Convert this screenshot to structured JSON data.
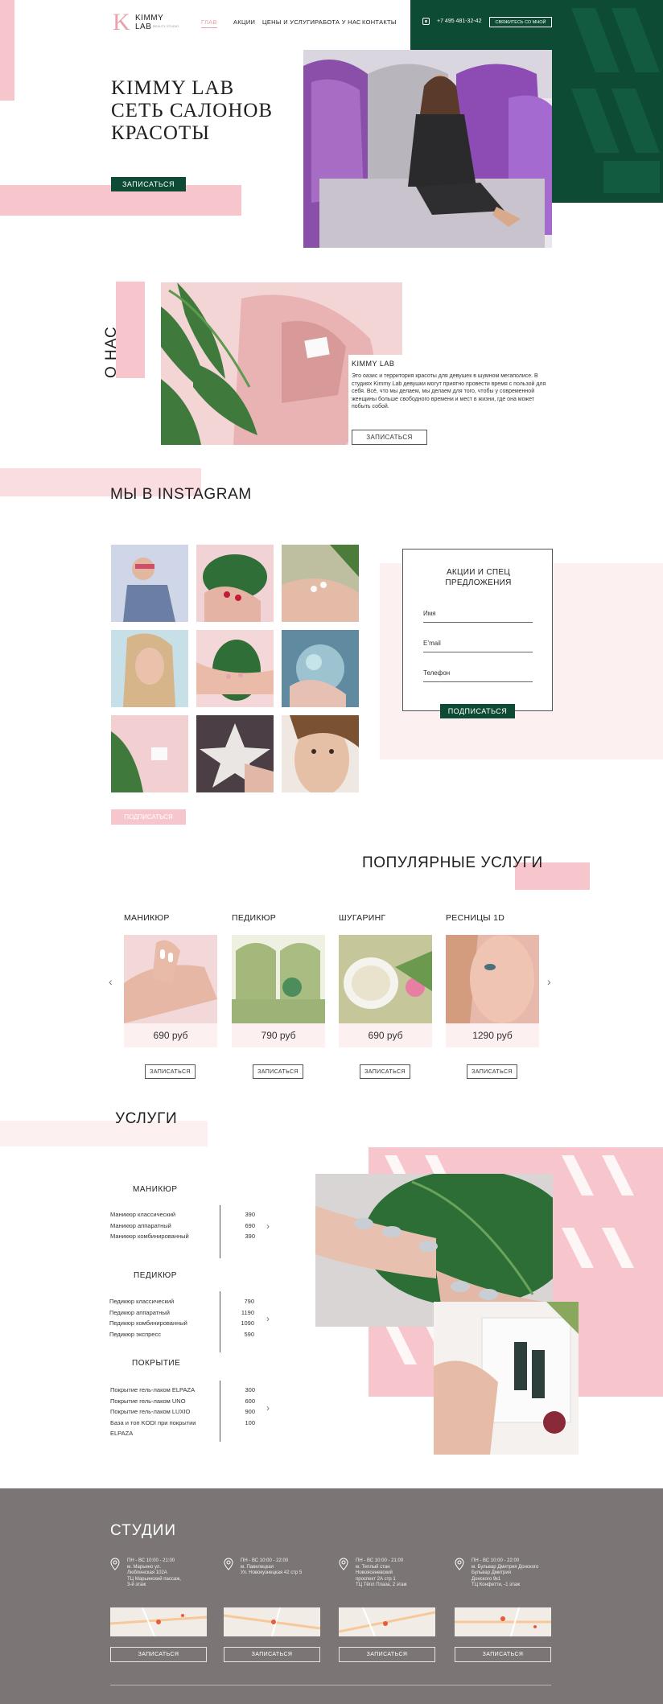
{
  "header": {
    "logo_letter": "K",
    "logo_name": "KIMMY LAB",
    "logo_sub": "BEAUTY STUDIO",
    "nav": [
      "ГЛАВ",
      "АКЦИИ",
      "ЦЕНЫ И УСЛУГИ",
      "РАБОТА У НАС",
      "КОНТАКТЫ"
    ],
    "phone": "+7 495 481-32-42",
    "contact_button": "СВЯЖИТЕСЬ СО МНОЙ"
  },
  "hero": {
    "title_lines": [
      "KIMMY LAB",
      "СЕТЬ САЛОНОВ",
      "КРАСОТЫ"
    ],
    "button": "ЗАПИСАТЬСЯ"
  },
  "about": {
    "vertical_title": "О НАС",
    "card_title": "KIMMY LAB",
    "text": "Это оазис и территория красоты для девушек в шумном мегаполисе. В студиях Kimmy Lab девушки могут приятно провести время с пользой для себя. Всё, что мы делаем, мы делаем для того, чтобы у современной женщины больше свободного времени и мест в жизни, где она может побыть собой.",
    "button": "ЗАПИСАТЬСЯ"
  },
  "instagram": {
    "title": "МЫ В INSTAGRAM",
    "subscribe_button": "ПОДПИСАТЬСЯ"
  },
  "promo_form": {
    "title": "АКЦИИ И СПЕЦ ПРЕДЛОЖЕНИЯ",
    "fields": [
      "Имя",
      "E’mail",
      "Телефон"
    ],
    "button": "ПОДПИСАТЬСЯ"
  },
  "popular": {
    "title": "ПОПУЛЯРНЫЕ УСЛУГИ",
    "cards": [
      {
        "name": "МАНИКЮР",
        "price": "690 руб",
        "button": "ЗАПИСАТЬСЯ"
      },
      {
        "name": "ПЕДИКЮР",
        "price": "790 руб",
        "button": "ЗАПИСАТЬСЯ"
      },
      {
        "name": "ШУГАРИНГ",
        "price": "690 руб",
        "button": "ЗАПИСАТЬСЯ"
      },
      {
        "name": "РЕСНИЦЫ 1D",
        "price": "1290 руб",
        "button": "ЗАПИСАТЬСЯ"
      }
    ],
    "prev": "‹",
    "next": "›"
  },
  "services": {
    "title": "УСЛУГИ",
    "groups": [
      {
        "title": "МАНИКЮР",
        "items": [
          {
            "name": "Маникюр классический",
            "price": "390"
          },
          {
            "name": "Маникюр аппаратный",
            "price": "690"
          },
          {
            "name": "Маникюр комбинированный",
            "price": "390"
          }
        ]
      },
      {
        "title": "ПЕДИКЮР",
        "items": [
          {
            "name": "Педикюр классический",
            "price": "790"
          },
          {
            "name": "Педикюр аппаратный",
            "price": "1190"
          },
          {
            "name": "Педикюр комбинированный",
            "price": "1090"
          },
          {
            "name": "Педикюр экспресс",
            "price": "590"
          }
        ]
      },
      {
        "title": "ПОКРЫТИЕ",
        "items": [
          {
            "name": "Покрытие гель-лаком ELPAZA",
            "price": "300"
          },
          {
            "name": "Покрытие гель-лаком UNO",
            "price": "600"
          },
          {
            "name": "Покрытие гель-лаком LUXIO",
            "price": "900"
          },
          {
            "name": "База и топ KODI при покрытии ELPAZA",
            "price": "100"
          }
        ]
      }
    ],
    "arrow": "›"
  },
  "studios": {
    "title": "СТУДИИ",
    "items": [
      {
        "address": "ПН - ВС 10:00 - 21:00\nм. Марьино ул.\nЛюблинская 102А\nТЦ Марьинский пассаж,\n3-й этаж",
        "button": "ЗАПИСАТЬСЯ"
      },
      {
        "address": "ПН - ВС 10:00 - 22:00\nм. Павелецкая\nУл. Новокузнецкая 42 стр 5",
        "button": "ЗАПИСАТЬСЯ"
      },
      {
        "address": "ПН - ВС 10:00 - 21:00\nм. Теплый стан\nНовоясеневский\nпроспект 2А стр 1\nТЦ Тёпл Плаза, 2 этаж",
        "button": "ЗАПИСАТЬСЯ"
      },
      {
        "address": "ПН - ВС 10:00 - 22:00\nм. Бульвар Дмитрия Донского\nБульвар Дмитрия\nДонского 9к1\nТЦ Конфетти, -1 этаж",
        "button": "ЗАПИСАТЬСЯ"
      }
    ]
  },
  "colors": {
    "accent_green": "#0e4b35",
    "accent_pink": "#f7c6cc",
    "pink_light": "#fdf0f1",
    "footer_gray": "#7b7675"
  }
}
